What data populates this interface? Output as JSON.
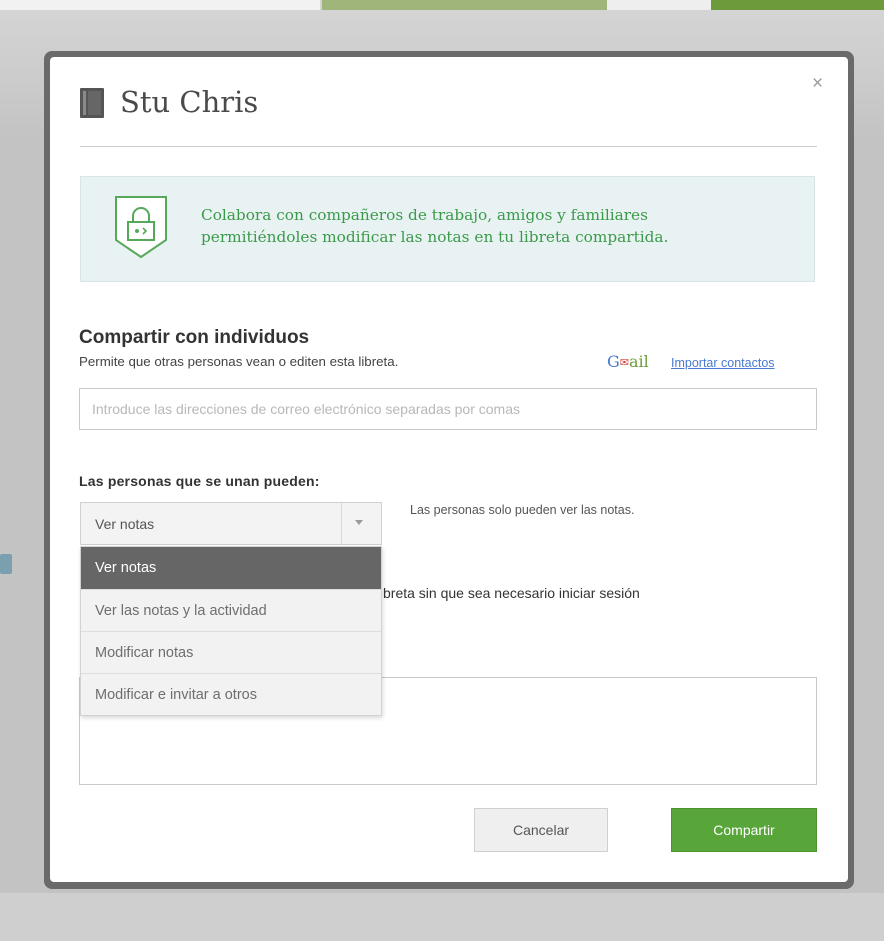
{
  "dialog": {
    "title": "Stu Chris",
    "close_label": "×"
  },
  "banner": {
    "line1": "Colabora con compañeros de trabajo, amigos y familiares",
    "line2": "permitiéndoles modificar las notas en tu libreta compartida."
  },
  "share": {
    "heading": "Compartir con individuos",
    "subtext": "Permite que otras personas vean o editen esta libreta.",
    "gmail_g": "G",
    "gmail_m": "✉",
    "gmail_rest": "ail",
    "import_link": "Importar contactos",
    "email_placeholder": "Introduce las direcciones de correo electrónico separadas por comas"
  },
  "permissions": {
    "label": "Las personas que se unan pueden:",
    "selected": "Ver notas",
    "description": "Las personas solo pueden ver las notas.",
    "options": [
      "Ver notas",
      "Ver las notas y la actividad",
      "Modificar notas",
      "Modificar e invitar a otros"
    ]
  },
  "partial_text": "breta sin que sea necesario iniciar sesión",
  "buttons": {
    "cancel": "Cancelar",
    "share": "Compartir"
  },
  "colors": {
    "accent_green": "#58a53a",
    "banner_text": "#3b9a4a",
    "link_blue": "#4a79d0"
  }
}
